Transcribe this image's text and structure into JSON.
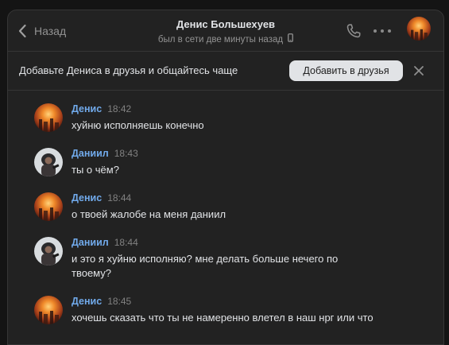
{
  "header": {
    "back_label": "Назад",
    "contact_name": "Денис Большехуев",
    "status": "был в сети две минуты назад",
    "icons": {
      "back": "chevron-left-icon",
      "phone_device": "mobile-phone-icon",
      "call": "phone-call-icon",
      "more": "more-dots-icon"
    }
  },
  "banner": {
    "text": "Добавьте Дениса в друзья и общайтесь чаще",
    "button_label": "Добавить в друзья",
    "close_icon": "close-icon"
  },
  "messages": [
    {
      "author": "Денис",
      "time": "18:42",
      "text": "хуйню исполняешь конечно",
      "avatar": "denis"
    },
    {
      "author": "Даниил",
      "time": "18:43",
      "text": "ты о чём?",
      "avatar": "daniil"
    },
    {
      "author": "Денис",
      "time": "18:44",
      "text": "о твоей жалобе на меня даниил",
      "avatar": "denis"
    },
    {
      "author": "Даниил",
      "time": "18:44",
      "text": "и это я хуйню исполняю? мне делать больше нечего по твоему?",
      "avatar": "daniil"
    },
    {
      "author": "Денис",
      "time": "18:45",
      "text": "хочешь сказать что ты не намеренно влетел в наш нрг или что",
      "avatar": "denis"
    }
  ],
  "colors": {
    "background": "#222222",
    "author_name": "#71aaeb",
    "text": "#e1e3e6",
    "muted": "#939393"
  }
}
